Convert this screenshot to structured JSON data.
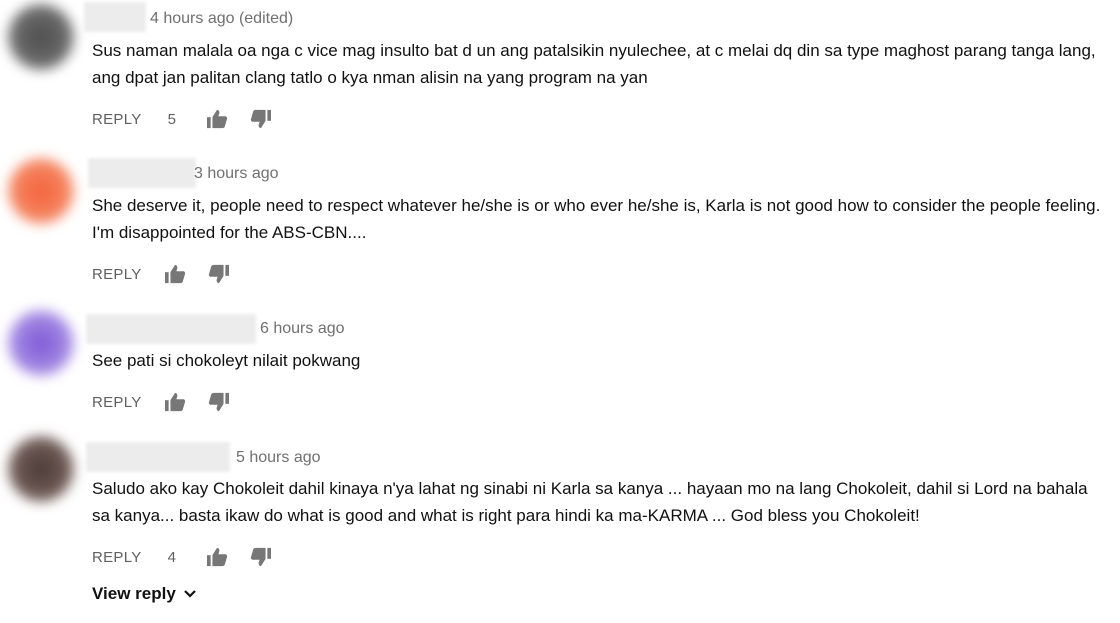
{
  "comments": [
    {
      "timestamp": "4 hours ago (edited)",
      "text": "Sus naman malala oa nga c vice mag insulto bat d un ang patalsikin nyulechee, at c melai dq din sa type maghost parang tanga lang, ang dpat jan palitan clang tatlo o kya nman alisin na yang program na yan",
      "reply_label": "REPLY",
      "likes": "5",
      "avatar_color": "#5a5a5a"
    },
    {
      "timestamp": "3 hours ago",
      "text": "She deserve it, people need to respect whatever he/she is or who ever he/she is, Karla is not good how to consider the people feeling. I'm disappointed for the ABS-CBN....",
      "reply_label": "REPLY",
      "likes": "",
      "avatar_color": "#f26a45"
    },
    {
      "timestamp": "6 hours ago",
      "text": "See pati si chokoleyt nilait pokwang",
      "reply_label": "REPLY",
      "likes": "",
      "avatar_color": "#8e6ad8"
    },
    {
      "timestamp": "5 hours ago",
      "text": "Saludo ako kay Chokoleit dahil kinaya n'ya lahat ng sinabi ni Karla sa kanya ... hayaan mo na lang Chokoleit, dahil si Lord na bahala sa kanya... basta ikaw do what is good and what is right para hindi ka ma-KARMA ... God bless you Chokoleit!",
      "reply_label": "REPLY",
      "likes": "4",
      "avatar_color": "#5b4a45"
    }
  ],
  "view_reply_label": "View reply",
  "icons": {
    "like": "thumb-up-icon",
    "dislike": "thumb-down-icon",
    "expand": "chevron-down-icon"
  }
}
